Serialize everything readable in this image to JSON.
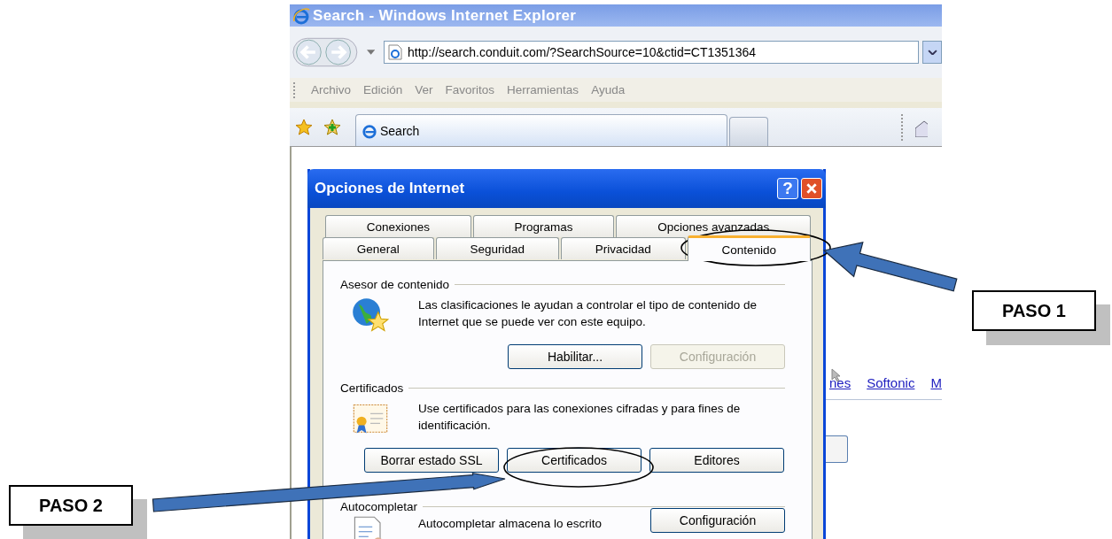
{
  "browser": {
    "title": "Search - Windows Internet Explorer",
    "address": "http://search.conduit.com/?SearchSource=10&ctid=CT1351364",
    "menu": [
      "Archivo",
      "Edición",
      "Ver",
      "Favoritos",
      "Herramientas",
      "Ayuda"
    ],
    "tabs": [
      {
        "label": "Search",
        "selected": true
      }
    ]
  },
  "page_links": [
    "nes",
    "Softonic",
    "M"
  ],
  "dialog": {
    "title": "Opciones de Internet",
    "help": "?",
    "tab_rows": [
      [
        {
          "label": "Conexiones",
          "selected": false
        },
        {
          "label": "Programas",
          "selected": false
        },
        {
          "label": "Opciones avanzadas",
          "selected": false
        }
      ],
      [
        {
          "label": "General",
          "selected": false
        },
        {
          "label": "Seguridad",
          "selected": false
        },
        {
          "label": "Privacidad",
          "selected": false
        },
        {
          "label": "Contenido",
          "selected": true
        }
      ]
    ],
    "sections": [
      {
        "title": "Asesor de contenido",
        "kind": "stacked",
        "text": "Las clasificaciones le ayudan a controlar el tipo de contenido de Internet que se puede ver con este equipo.",
        "buttons": [
          {
            "label": "Habilitar...",
            "disabled": false
          },
          {
            "label": "Configuración",
            "disabled": true
          }
        ]
      },
      {
        "title": "Certificados",
        "kind": "row",
        "text": "Use certificados para las conexiones cifradas y para fines de identificación.",
        "buttons": [
          {
            "label": "Borrar estado SSL",
            "disabled": false
          },
          {
            "label": "Certificados",
            "disabled": false
          },
          {
            "label": "Editores",
            "disabled": false
          }
        ]
      },
      {
        "title": "Autocompletar",
        "kind": "side",
        "text": "Autocompletar almacena lo escrito",
        "buttons": [
          {
            "label": "Configuración",
            "disabled": false
          }
        ]
      }
    ]
  },
  "annotations": [
    {
      "label": "PASO 1"
    },
    {
      "label": "PASO 2"
    }
  ]
}
